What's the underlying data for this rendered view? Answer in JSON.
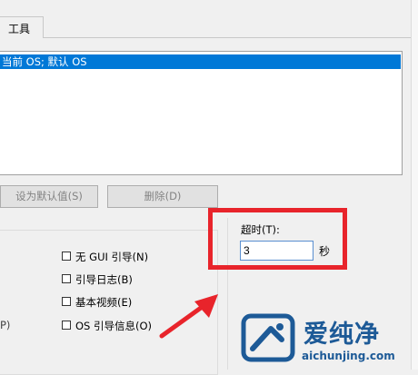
{
  "tabs": {
    "active_label": "工具"
  },
  "os_list": {
    "selected_item": "当前 OS; 默认 OS"
  },
  "buttons": {
    "set_default": "设为默认值(S)",
    "delete": "删除(D)"
  },
  "boot_options": {
    "hotkey_fragment": "P)",
    "items": [
      {
        "label": "无 GUI 引导(N)",
        "checked": false
      },
      {
        "label": "引导日志(B)",
        "checked": false
      },
      {
        "label": "基本视频(E)",
        "checked": false
      },
      {
        "label": "OS 引导信息(O)",
        "checked": false
      }
    ]
  },
  "timeout": {
    "label": "超时(T):",
    "value": "3",
    "unit": "秒"
  },
  "annotation": {
    "box_color": "#e8242b",
    "arrow_icon": "arrow-icon"
  },
  "watermark": {
    "title": "爱纯净",
    "url": "aichunjing.com",
    "color": "#1d5a97"
  },
  "colors": {
    "selection": "#0078d7",
    "accent_red": "#e8242b"
  }
}
